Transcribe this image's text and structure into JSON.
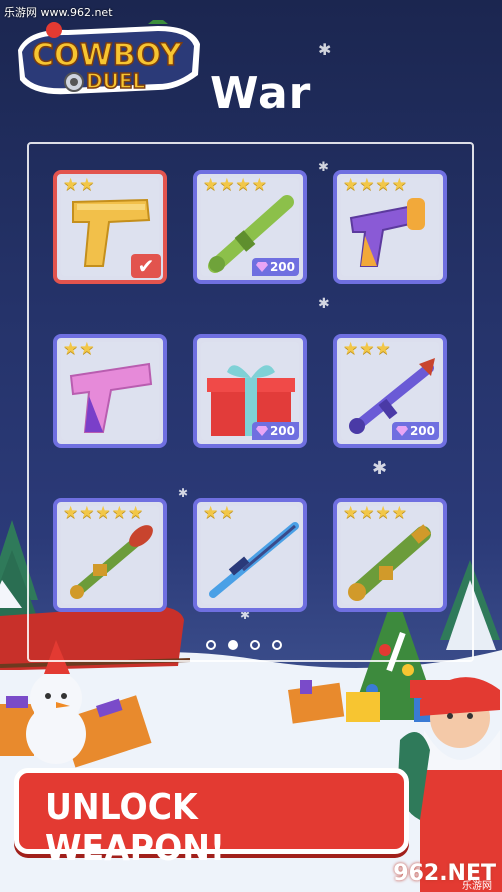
{
  "watermark": "乐游网 www.962.net",
  "logo": {
    "line1": "COWBOY",
    "line2": "DUEL"
  },
  "title": "War",
  "cards": [
    {
      "stars": 2,
      "price": null,
      "selected": true,
      "weapon": "gold-pistol"
    },
    {
      "stars": 4,
      "price": "200",
      "selected": false,
      "weapon": "green-bazooka"
    },
    {
      "stars": 4,
      "price": null,
      "selected": false,
      "weapon": "purple-revolver"
    },
    {
      "stars": 2,
      "price": null,
      "selected": false,
      "weapon": "pink-pistol"
    },
    {
      "stars": 0,
      "price": "200",
      "selected": false,
      "weapon": "gift-box"
    },
    {
      "stars": 3,
      "price": "200",
      "selected": false,
      "weapon": "purple-rpg"
    },
    {
      "stars": 5,
      "price": null,
      "selected": false,
      "weapon": "green-rpg"
    },
    {
      "stars": 2,
      "price": null,
      "selected": false,
      "weapon": "blue-sniper"
    },
    {
      "stars": 4,
      "price": null,
      "selected": false,
      "weapon": "green-launcher"
    }
  ],
  "pager": {
    "count": 4,
    "active": 1
  },
  "banner": {
    "label": "UNLOCK WEAPON!"
  },
  "brand": {
    "name": "962.NET",
    "sub": "乐游网"
  },
  "colors": {
    "card_border": "#6f6fe0",
    "selected_border": "#e2544e",
    "banner": "#e33a32",
    "star": "#f2c748"
  }
}
